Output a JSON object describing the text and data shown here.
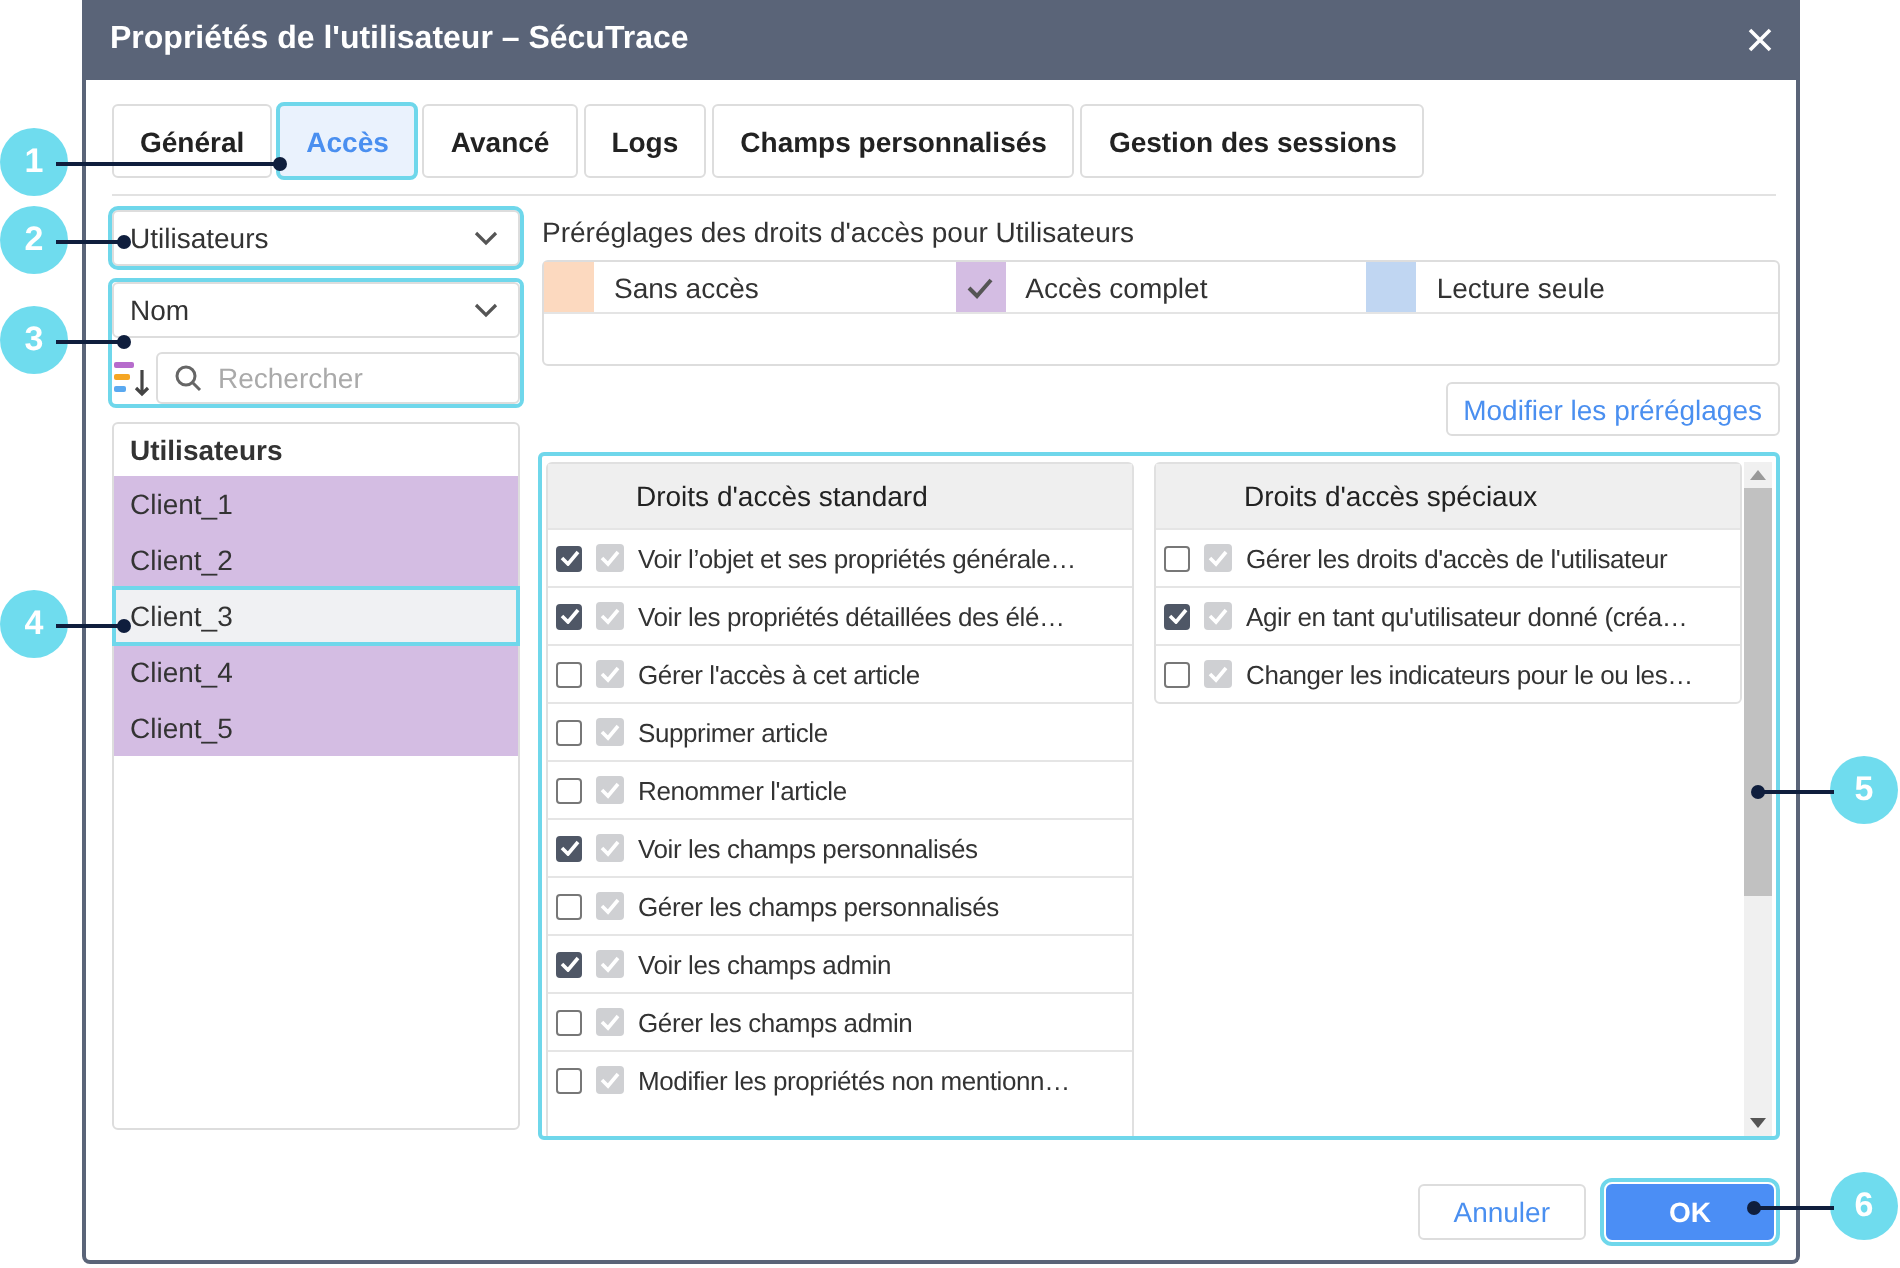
{
  "window": {
    "title": "Propriétés de l'utilisateur – SécuTrace"
  },
  "tabs": [
    {
      "label": "Général",
      "selected": false
    },
    {
      "label": "Accès",
      "selected": true
    },
    {
      "label": "Avancé",
      "selected": false
    },
    {
      "label": "Logs",
      "selected": false
    },
    {
      "label": "Champs personnalisés",
      "selected": false
    },
    {
      "label": "Gestion des sessions",
      "selected": false
    }
  ],
  "object_type_select": {
    "value": "Utilisateurs"
  },
  "sort_select": {
    "value": "Nom"
  },
  "search": {
    "placeholder": "Rechercher"
  },
  "user_list": {
    "header": "Utilisateurs",
    "items": [
      {
        "label": "Client_1",
        "color": "#d4bde3",
        "selected": false
      },
      {
        "label": "Client_2",
        "color": "#d4bde3",
        "selected": false
      },
      {
        "label": "Client_3",
        "selected": true
      },
      {
        "label": "Client_4",
        "color": "#d4bde3",
        "selected": false
      },
      {
        "label": "Client_5",
        "color": "#d4bde3",
        "selected": false
      }
    ]
  },
  "presets": {
    "title": "Préréglages des droits d'accès pour Utilisateurs",
    "items": [
      {
        "label": "Sans accès",
        "color": "#fcd9bf",
        "selected": false
      },
      {
        "label": "Accès complet",
        "color": "#d4bde3",
        "selected": true
      },
      {
        "label": "Lecture seule",
        "color": "#c0d6f2",
        "selected": false
      }
    ],
    "edit_button": "Modifier les préréglages"
  },
  "standard_rights": {
    "title": "Droits d'accès standard",
    "items": [
      {
        "label": "Voir l’objet et ses propriétés générale…",
        "checked": true
      },
      {
        "label": "Voir les propriétés détaillées des élé…",
        "checked": true
      },
      {
        "label": "Gérer l'accès à cet article",
        "checked": false
      },
      {
        "label": "Supprimer article",
        "checked": false
      },
      {
        "label": "Renommer l'article",
        "checked": false
      },
      {
        "label": "Voir les champs personnalisés",
        "checked": true
      },
      {
        "label": "Gérer les champs personnalisés",
        "checked": false
      },
      {
        "label": "Voir les champs admin",
        "checked": true
      },
      {
        "label": "Gérer les champs admin",
        "checked": false
      },
      {
        "label": "Modifier les propriétés non mentionn…",
        "checked": false
      }
    ]
  },
  "special_rights": {
    "title": "Droits d'accès spéciaux",
    "items": [
      {
        "label": "Gérer les droits d'accès de l'utilisateur",
        "checked": false
      },
      {
        "label": "Agir en tant qu'utilisateur donné (créa…",
        "checked": true
      },
      {
        "label": "Changer les indicateurs pour le ou les…",
        "checked": false
      }
    ]
  },
  "buttons": {
    "cancel": "Annuler",
    "ok": "OK"
  },
  "callouts": [
    "1",
    "2",
    "3",
    "4",
    "5",
    "6"
  ]
}
